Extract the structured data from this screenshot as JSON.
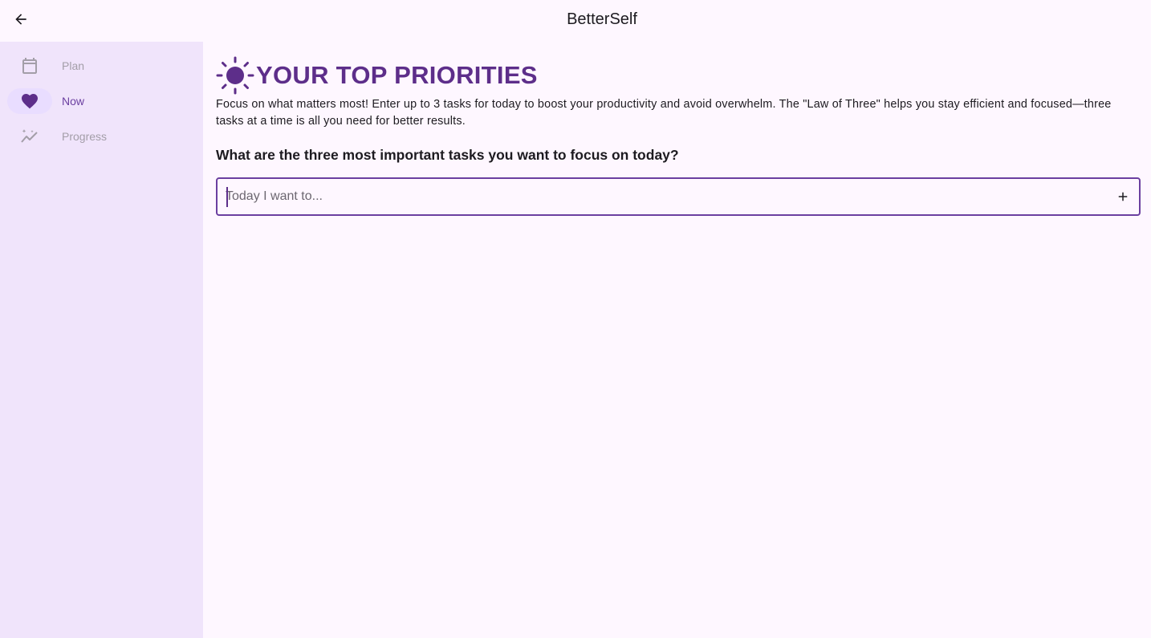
{
  "app": {
    "title": "BetterSelf"
  },
  "sidebar": {
    "items": [
      {
        "label": "Plan",
        "icon": "calendar-icon",
        "active": false
      },
      {
        "label": "Now",
        "icon": "heart-icon",
        "active": true
      },
      {
        "label": "Progress",
        "icon": "trending-up-icon",
        "active": false
      }
    ]
  },
  "main": {
    "title": "YOUR TOP PRIORITIES",
    "title_icon": "sun-icon",
    "description": "Focus on what matters most! Enter up to 3 tasks for today to boost your productivity and avoid overwhelm. The \"Law of Three\" helps you stay efficient and focused—three tasks at a time is all you need for better results.",
    "question": "What are the three most important tasks you want to focus on today?",
    "task_input": {
      "value": "",
      "placeholder": "Today I want to..."
    },
    "add_icon": "plus-icon"
  },
  "colors": {
    "accent": "#6b3fa0",
    "title": "#5d2e8a",
    "background": "#fef7ff",
    "sidebar": "#f0e4fb"
  }
}
